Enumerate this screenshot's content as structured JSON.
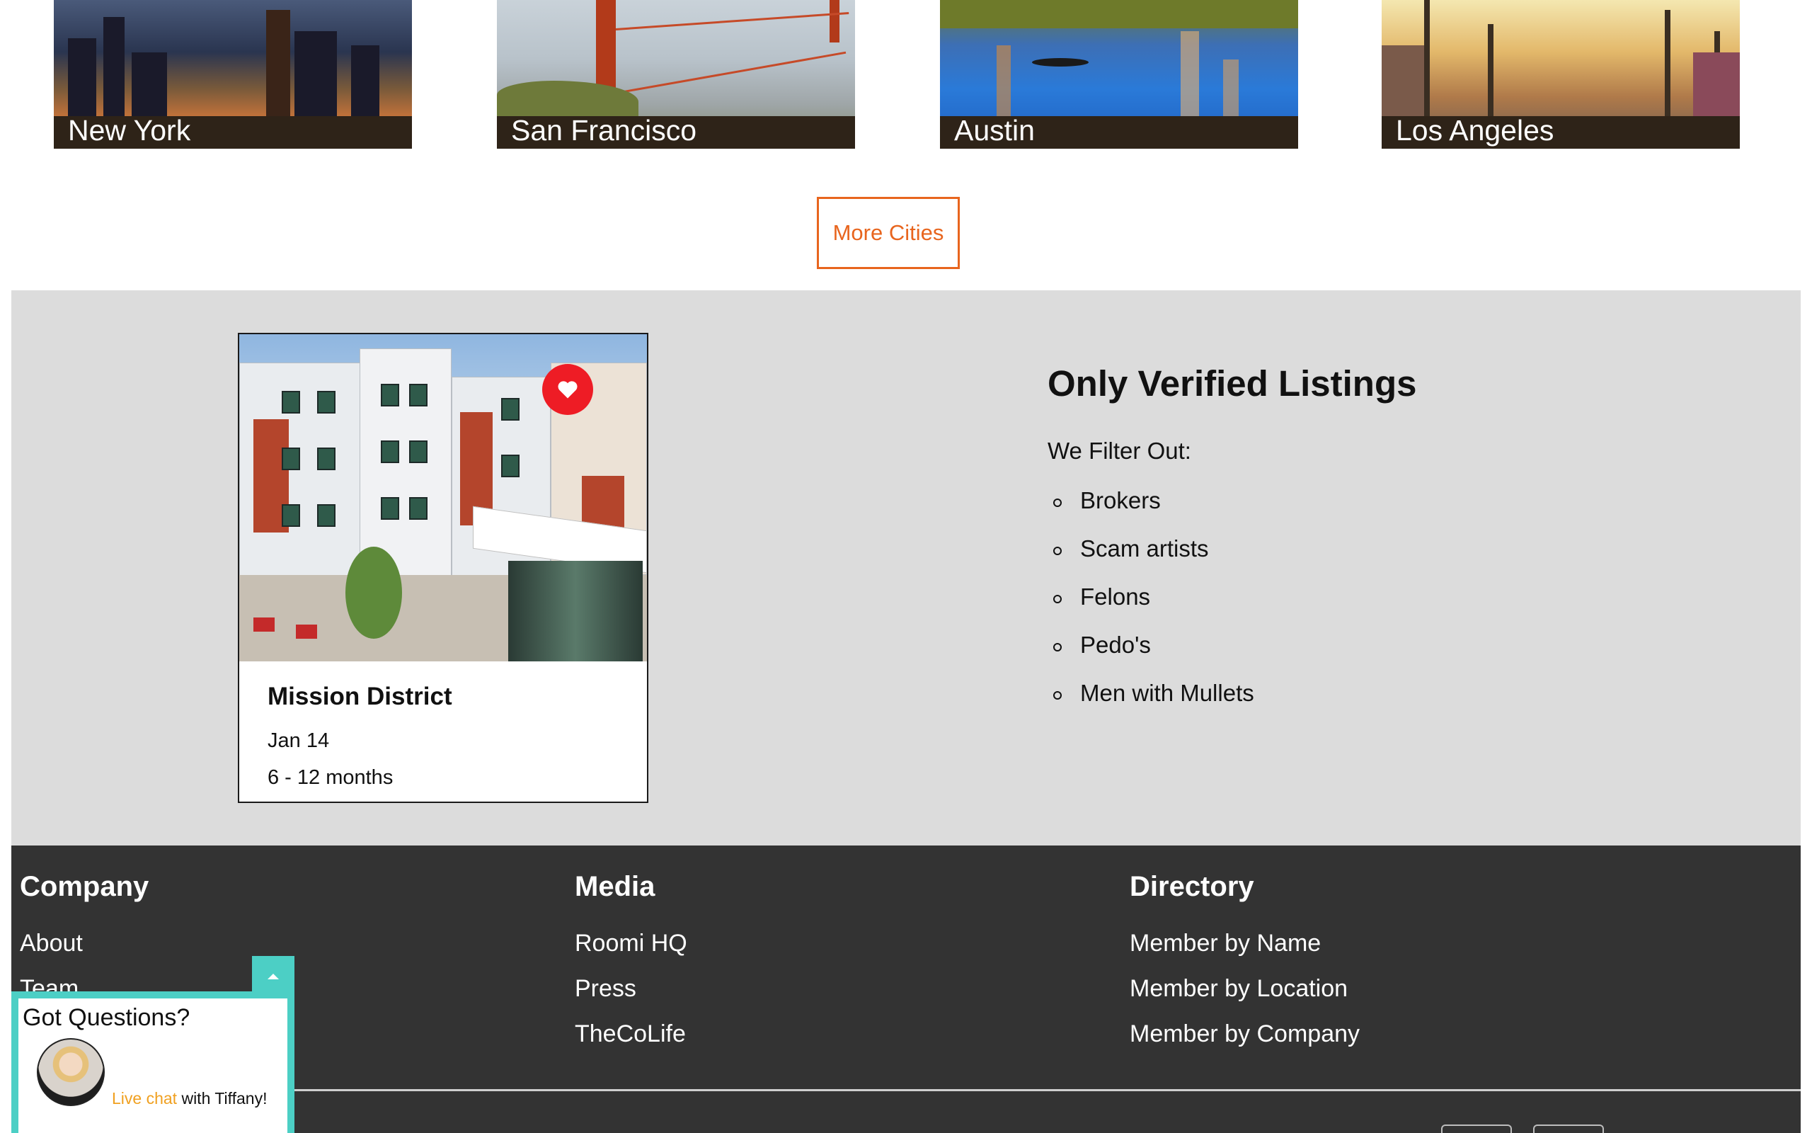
{
  "cities": [
    {
      "name": "New York"
    },
    {
      "name": "San Francisco"
    },
    {
      "name": "Austin"
    },
    {
      "name": "Los Angeles"
    }
  ],
  "more_cities_label": "More Cities",
  "listing": {
    "title": "Mission District",
    "date": "Jan 14",
    "duration": "6 - 12 months"
  },
  "verified": {
    "title": "Only Verified Listings",
    "intro": "We Filter Out:",
    "items": [
      "Brokers",
      "Scam artists",
      "Felons",
      "Pedo's",
      "Men with Mullets"
    ]
  },
  "footer": {
    "company": {
      "heading": "Company",
      "links": [
        "About",
        "Team"
      ]
    },
    "media": {
      "heading": "Media",
      "links": [
        "Roomi HQ",
        "Press",
        "TheCoLife"
      ]
    },
    "directory": {
      "heading": "Directory",
      "links": [
        "Member by Name",
        "Member by Location",
        "Member by Company"
      ]
    }
  },
  "chat": {
    "question": "Got Questions?",
    "cta_highlight": "Live chat",
    "cta_rest": " with Tiffany!"
  },
  "colors": {
    "accent_orange": "#e8651e",
    "chat_teal": "#4ccfc5",
    "heart_red": "#ee1c25",
    "footer_bg": "#333333",
    "section_gray": "#dcdcdc"
  },
  "icons": {
    "favorite": "heart-icon",
    "chat_toggle": "chevron-up-icon"
  }
}
